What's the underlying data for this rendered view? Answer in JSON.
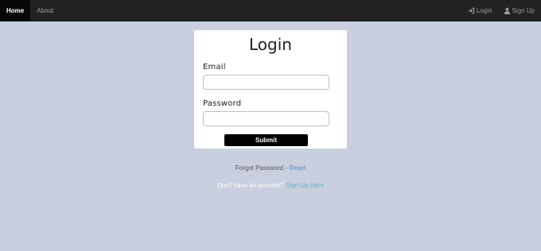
{
  "nav": {
    "home_label": "Home",
    "about_label": "About",
    "login_label": "Login",
    "signup_label": "Sign Up",
    "login_icon": "login-arrow-icon",
    "signup_icon": "user-icon"
  },
  "form": {
    "title": "Login",
    "email_label": "Email",
    "email_value": "",
    "password_label": "Password",
    "password_value": "",
    "submit_label": "Submit"
  },
  "footer": {
    "forgot_text": "Forgot Password - ",
    "reset_link": "Reset",
    "no_account_text": "Don't have an account? ",
    "signup_link": "Sign Up Here"
  },
  "colors": {
    "background": "#c9cfdf",
    "navbar": "#222222",
    "link": "#4a8fc4",
    "signup_link": "#5fb6c7"
  }
}
